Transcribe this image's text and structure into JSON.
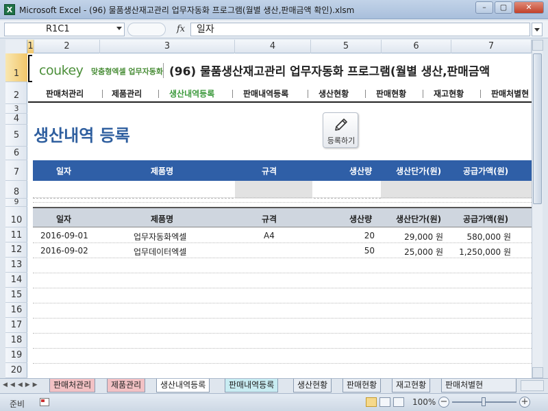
{
  "window": {
    "title": "Microsoft Excel - (96) 물품생산재고관리 업무자동화 프로그램(월별 생산,판매금액 확인).xlsm",
    "app_icon": "X",
    "minimize": "–",
    "restore": "▢",
    "close": "✕"
  },
  "formula_bar": {
    "name_box": "R1C1",
    "fx": "fx",
    "content": "일자"
  },
  "columns": [
    "1",
    "2",
    "3",
    "4",
    "5",
    "6",
    "7"
  ],
  "rows": [
    "1",
    "2",
    "3",
    "4",
    "5",
    "6",
    "7",
    "8",
    "9",
    "10",
    "11",
    "12",
    "13",
    "14",
    "15",
    "16",
    "17",
    "18",
    "19",
    "20"
  ],
  "brand": {
    "logo": "coukey",
    "sub": "맞춤형엑셀 업무자동화",
    "title": "(96) 물품생산재고관리 업무자동화 프로그램(월별 생산,판매금액"
  },
  "nav": {
    "items": [
      "판매처관리",
      "제품관리",
      "생산내역등록",
      "판매내역등록",
      "생산현황",
      "판매현황",
      "재고현황",
      "판매처별현"
    ],
    "active": "생산내역등록"
  },
  "page": {
    "heading": "생산내역 등록",
    "register_button": "등록하기"
  },
  "entry_table": {
    "headers": [
      "일자",
      "제품명",
      "규격",
      "생산량",
      "생산단가(원)",
      "공급가액(원)"
    ]
  },
  "list_table": {
    "headers": [
      "일자",
      "제품명",
      "규격",
      "생산량",
      "생산단가(원)",
      "공급가액(원)"
    ],
    "rows": [
      [
        "2016-09-01",
        "업무자동화엑셀",
        "A4",
        "20",
        "29,000 원",
        "580,000 원"
      ],
      [
        "2016-09-02",
        "업무데이터엑셀",
        "",
        "50",
        "25,000 원",
        "1,250,000 원"
      ]
    ]
  },
  "sheet_tabs": [
    {
      "label": "판매처관리",
      "color": "#f2c1c4"
    },
    {
      "label": "제품관리",
      "color": "#f2c1c4"
    },
    {
      "label": "생산내역등록",
      "color": "#ffffff"
    },
    {
      "label": "판매내역등록",
      "color": "#c8ecf2"
    },
    {
      "label": "생산현황",
      "color": "#e8edf3"
    },
    {
      "label": "판매현황",
      "color": "#e8edf3"
    },
    {
      "label": "재고현황",
      "color": "#e8edf3"
    },
    {
      "label": "판매처별현",
      "color": "#e8edf3"
    }
  ],
  "status": {
    "ready": "준비",
    "zoom": "100%",
    "zoom_minus": "−",
    "zoom_plus": "+"
  },
  "colors": {
    "header_blue": "#2f5fa7",
    "heading_blue": "#2f5f9f",
    "active_nav": "#3c9a3c",
    "brand_green": "#4c8f3a"
  }
}
